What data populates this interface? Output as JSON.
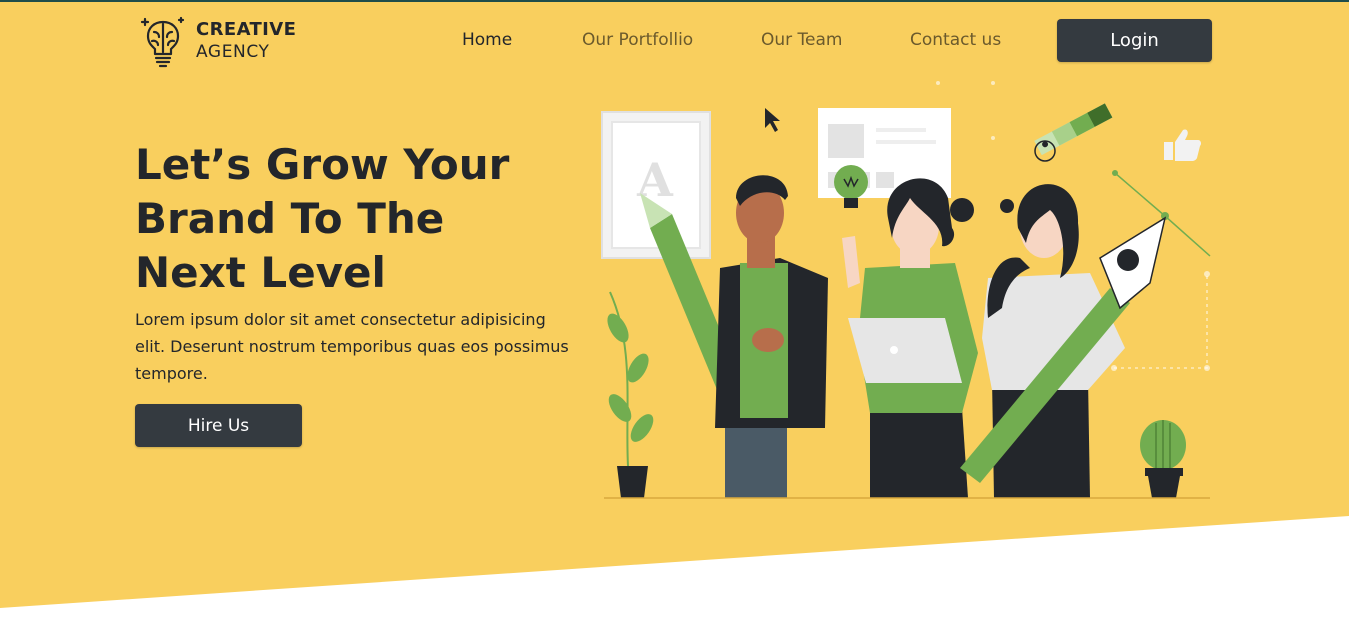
{
  "brand": {
    "line1": "CREATIVE",
    "line2": "AGENCY"
  },
  "nav": {
    "items": [
      {
        "label": "Home",
        "active": true
      },
      {
        "label": "Our Portfollio",
        "active": false
      },
      {
        "label": "Our Team",
        "active": false
      },
      {
        "label": "Contact us",
        "active": false
      }
    ],
    "login_label": "Login"
  },
  "hero": {
    "title_line1": "Let’s Grow Your",
    "title_line2": "Brand To The",
    "title_line3": "Next Level",
    "description": "Lorem ipsum dolor sit amet consectetur adipisicing elit. Deserunt nostrum temporibus quas eos possimus tempore.",
    "cta_label": "Hire Us",
    "illustration_letter": "A"
  },
  "colors": {
    "hero_background": "#f9cf5e",
    "button": "#343a40",
    "text_dark": "#23262b",
    "nav_muted": "#6b5a2c",
    "accent_green": "#72ad50"
  }
}
